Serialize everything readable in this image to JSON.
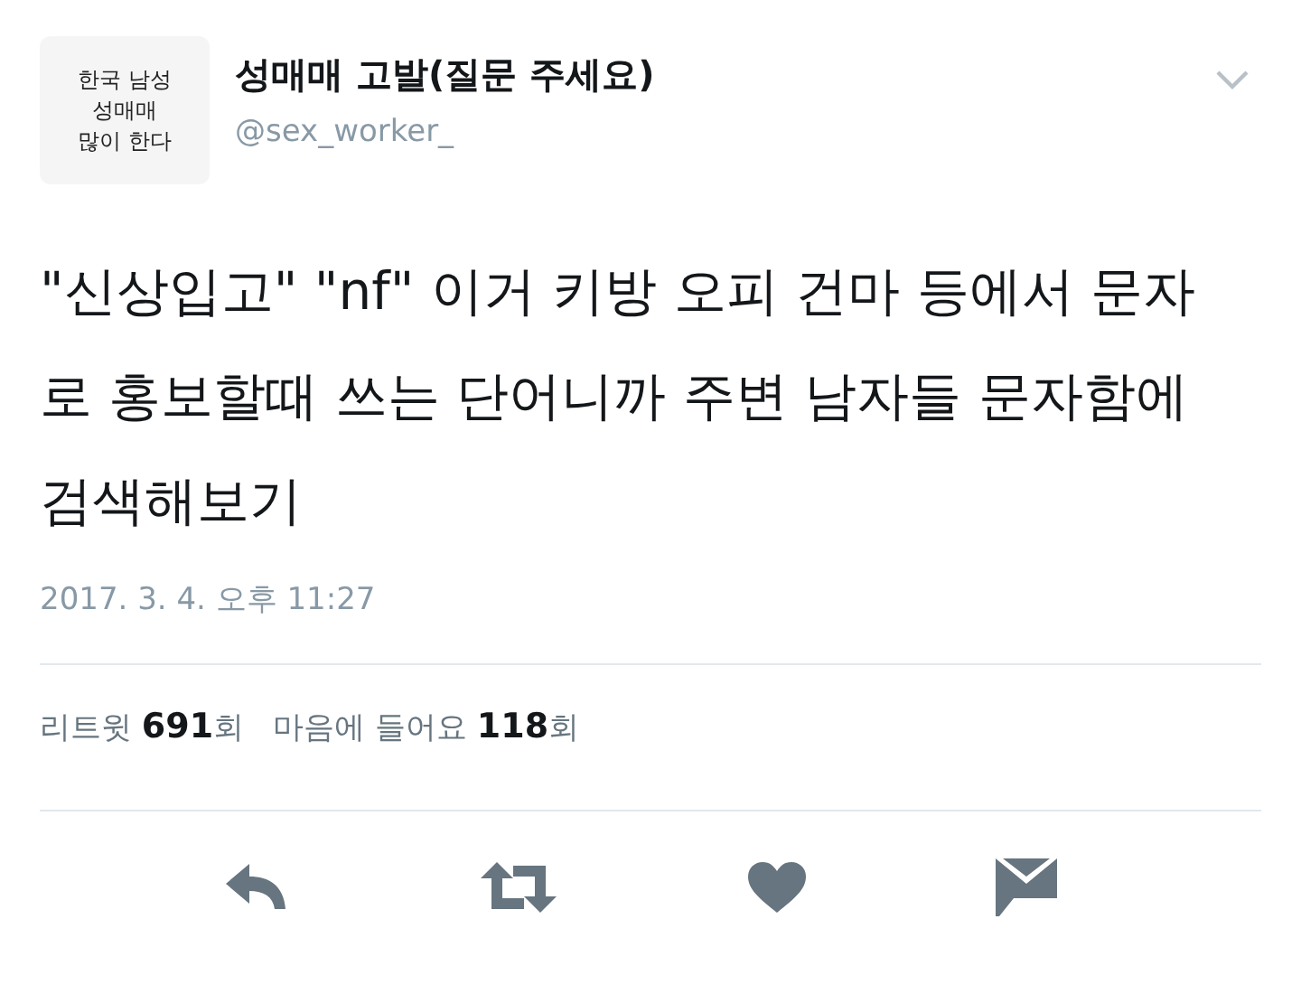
{
  "avatar": {
    "lines": [
      "한국 남성",
      "성매매",
      "많이 한다"
    ]
  },
  "author": {
    "name": "성매매 고발(질문 주세요)",
    "handle": "@sex_worker_"
  },
  "tweet": {
    "text": "\"신상입고\" \"nf\" 이거 키방 오피 건마 등에서 문자로 홍보할때 쓰는 단어니까 주변 남자들 문자함에 검색해보기",
    "time": "2017. 3. 4. 오후 11:27"
  },
  "stats": [
    "리트윗 **691**회",
    "마음에 들어요 **118**회"
  ],
  "actions": [
    {
      "kind": "reply"
    },
    {
      "kind": "retweet"
    },
    {
      "kind": "like"
    },
    {
      "kind": "message"
    }
  ]
}
